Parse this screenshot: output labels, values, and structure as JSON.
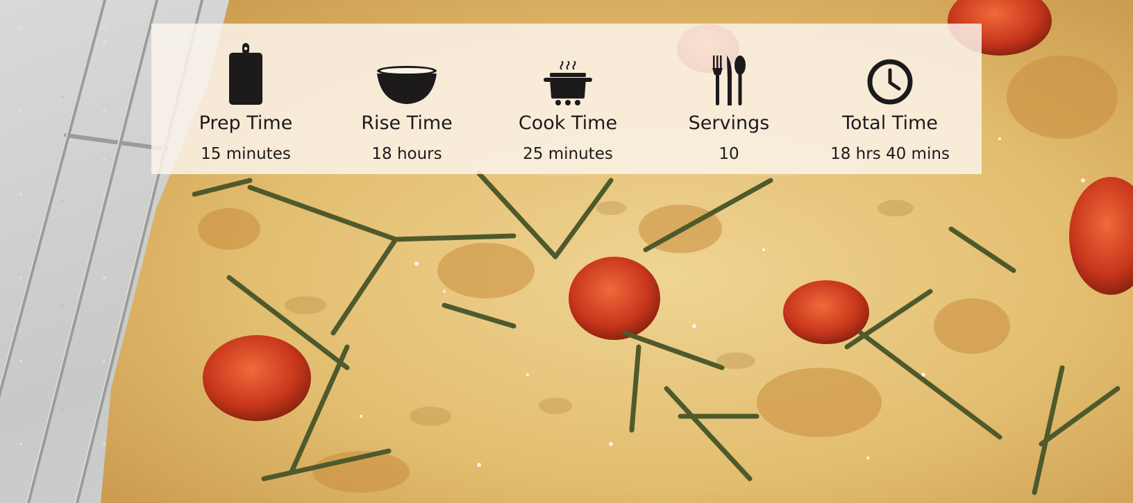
{
  "colors": {
    "panel_background": "#fcf4ec",
    "text": "#1c1a1a",
    "icon": "#1c1a1a"
  },
  "recipe_stats": [
    {
      "icon": "cutting-board-icon",
      "label": "Prep Time",
      "value": "15 minutes"
    },
    {
      "icon": "bowl-icon",
      "label": "Rise Time",
      "value": "18 hours"
    },
    {
      "icon": "cooking-pot-icon",
      "label": "Cook Time",
      "value": "25 minutes"
    },
    {
      "icon": "utensils-icon",
      "label": "Servings",
      "value": "10"
    },
    {
      "icon": "clock-icon",
      "label": "Total Time",
      "value": "18 hrs 40 mins"
    }
  ]
}
